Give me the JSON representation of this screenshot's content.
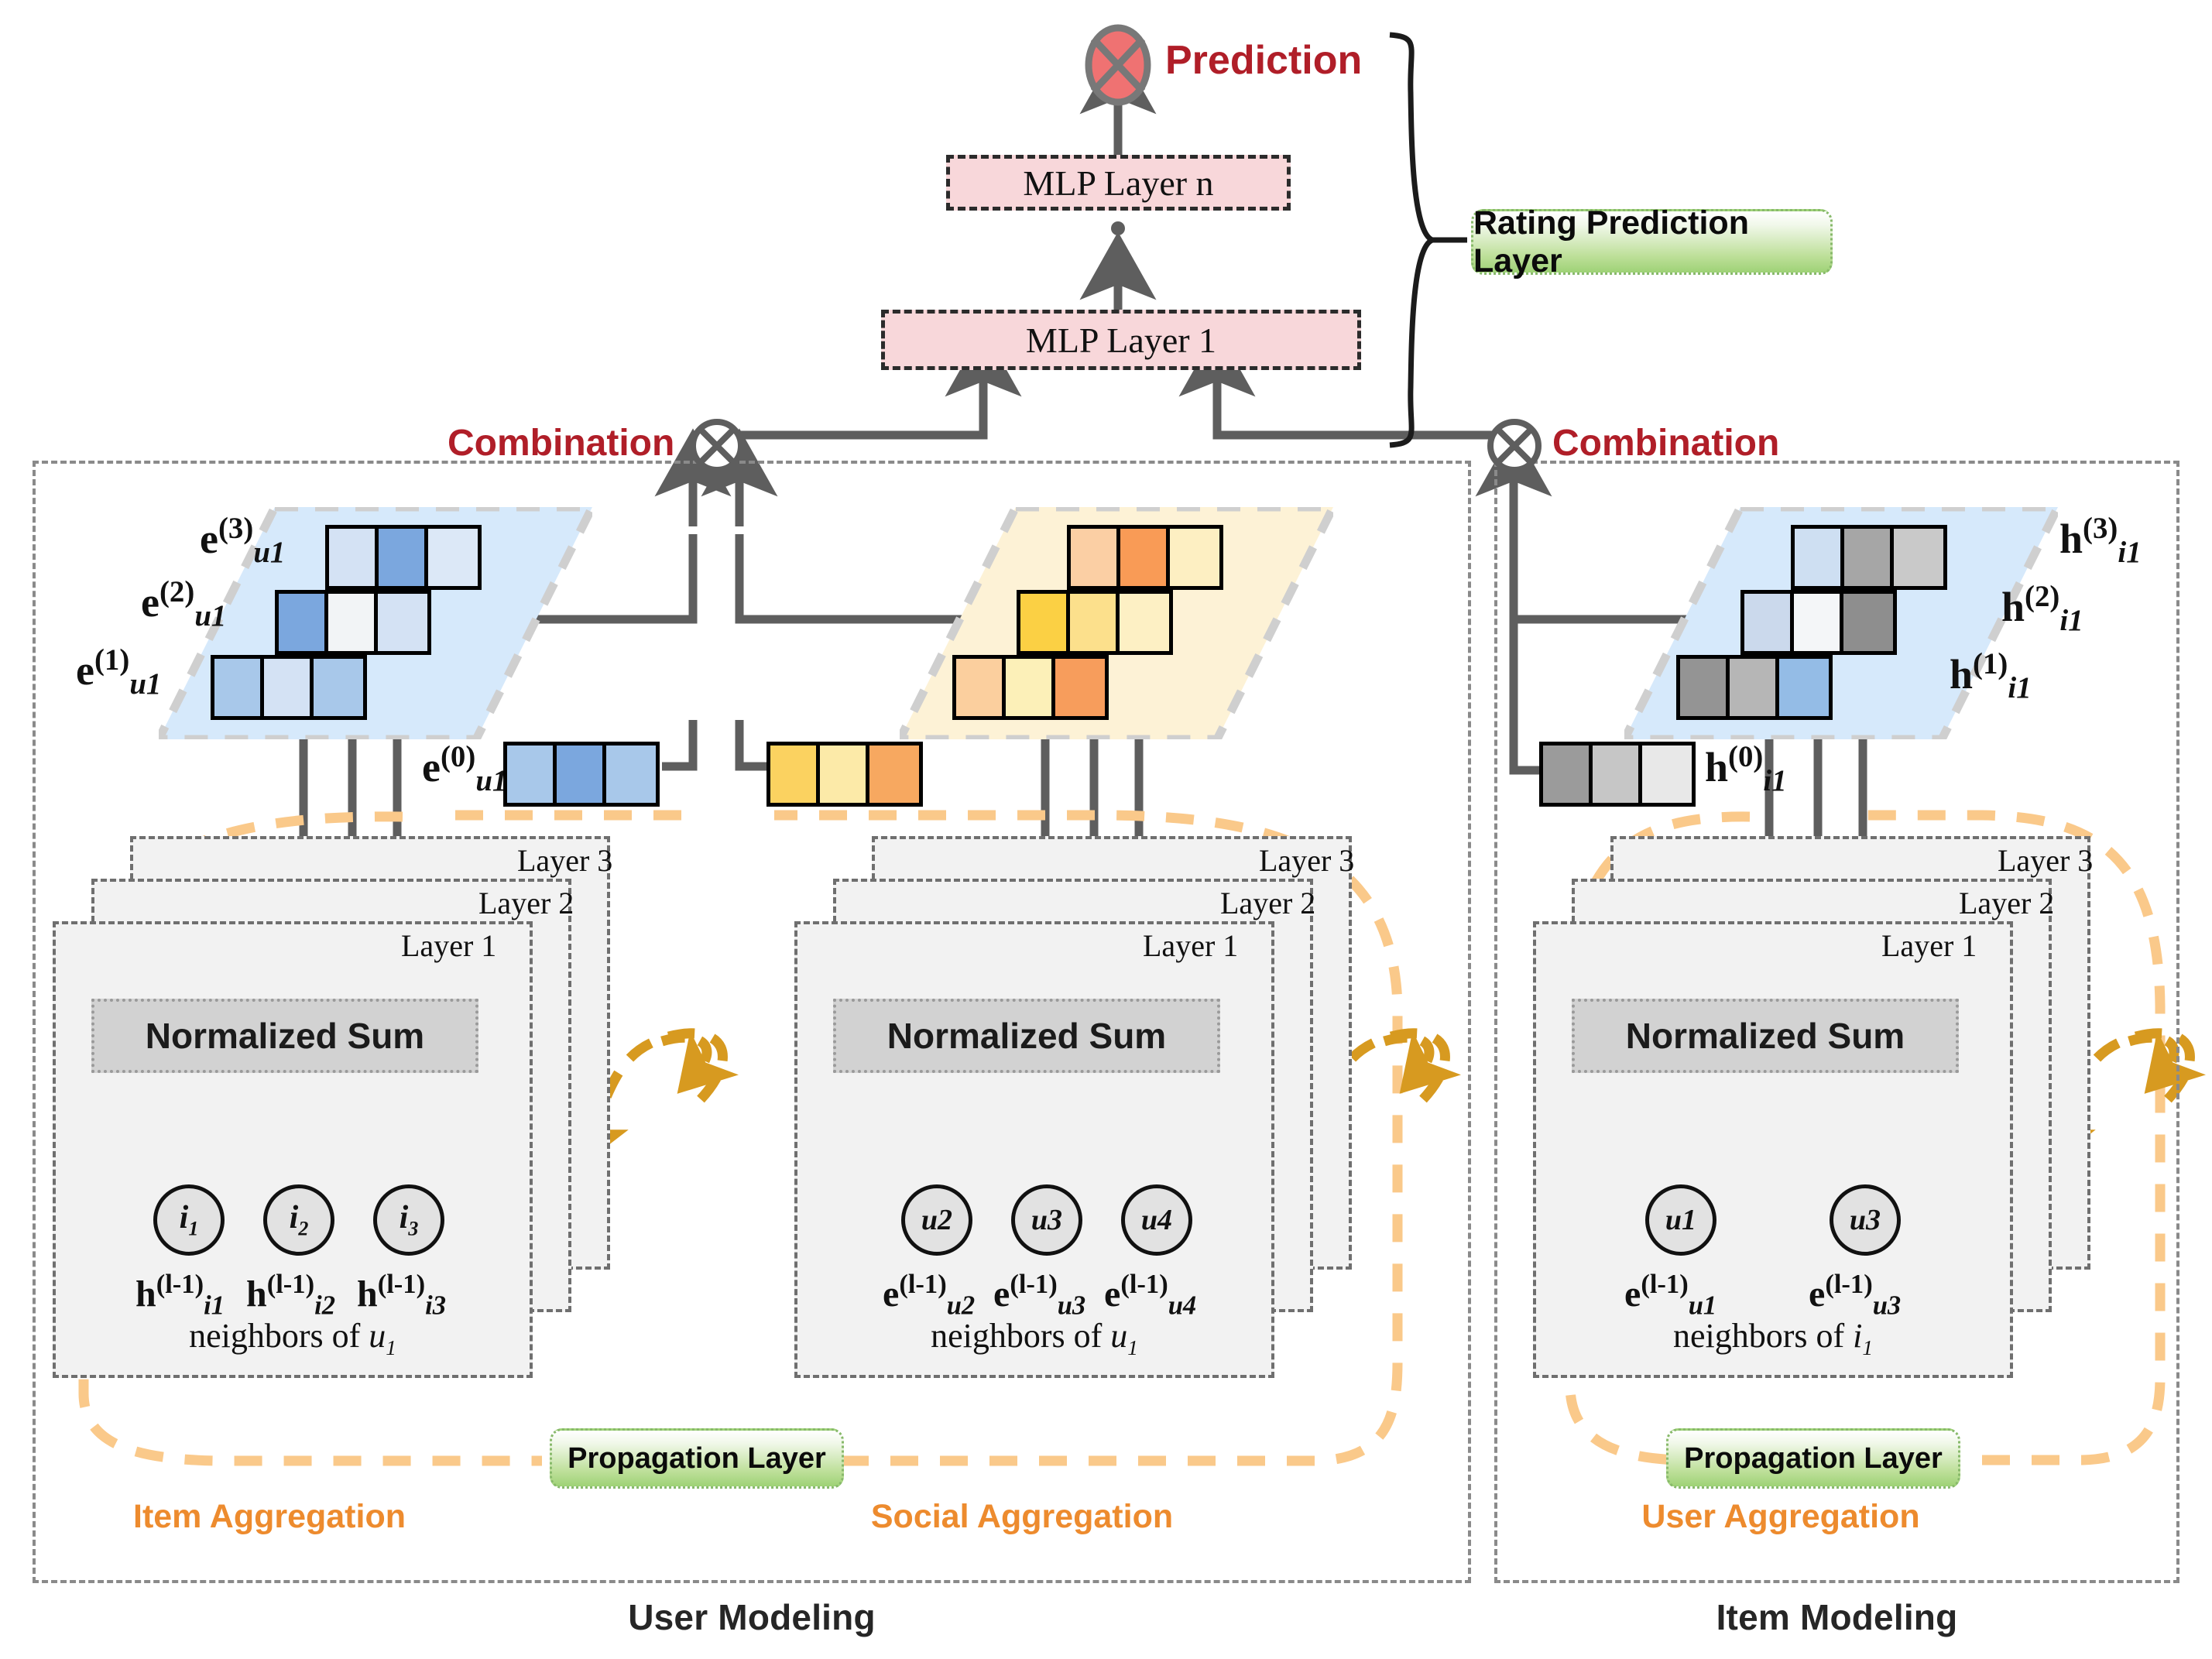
{
  "title_bottom": {
    "user_modeling": "User Modeling",
    "item_modeling": "Item Modeling"
  },
  "prediction": {
    "label": "Prediction",
    "icon": "prediction-circle-x-icon"
  },
  "mlp": {
    "top_label": "MLP Layer n",
    "bottom_label": "MLP Layer 1",
    "dots": "⋮"
  },
  "badges": {
    "rating_prediction": "Rating Prediction Layer",
    "propagation": "Propagation Layer"
  },
  "combination": {
    "left_label": "Combination",
    "right_label": "Combination",
    "icon": "combination-cross-circle-icon"
  },
  "aggregation_captions": {
    "item": "Item Aggregation",
    "social": "Social Aggregation",
    "user": "User Aggregation"
  },
  "layer_cards": {
    "layer1": "Layer 1",
    "layer2": "Layer 2",
    "layer3": "Layer 3",
    "normalized_sum": "Normalized Sum"
  },
  "columns": [
    {
      "id": "item-aggregation",
      "caption": "Item Aggregation",
      "neighbors_label": "neighbors of u",
      "neighbors_label_sub": "1",
      "nodes": [
        {
          "name": "i",
          "sub": "1",
          "embed": "h",
          "embed_sub": "i1",
          "embed_sup": "(l-1)"
        },
        {
          "name": "i",
          "sub": "2",
          "embed": "h",
          "embed_sub": "i2",
          "embed_sup": "(l-1)"
        },
        {
          "name": "i",
          "sub": "3",
          "embed": "h",
          "embed_sub": "i3",
          "embed_sup": "(l-1)"
        }
      ]
    },
    {
      "id": "social-aggregation",
      "caption": "Social Aggregation",
      "neighbors_label": "neighbors of u",
      "neighbors_label_sub": "1",
      "nodes": [
        {
          "name": "u2",
          "sub": "",
          "embed": "e",
          "embed_sub": "u2",
          "embed_sup": "(l-1)"
        },
        {
          "name": "u3",
          "sub": "",
          "embed": "e",
          "embed_sub": "u3",
          "embed_sup": "(l-1)"
        },
        {
          "name": "u4",
          "sub": "",
          "embed": "e",
          "embed_sub": "u4",
          "embed_sup": "(l-1)"
        }
      ]
    },
    {
      "id": "user-aggregation",
      "caption": "User Aggregation",
      "neighbors_label": "neighbors of i",
      "neighbors_label_sub": "1",
      "nodes": [
        {
          "name": "u1",
          "sub": "",
          "embed": "e",
          "embed_sub": "u1",
          "embed_sup": "(l-1)"
        },
        {
          "name": "u3",
          "sub": "",
          "embed": "e",
          "embed_sub": "u3",
          "embed_sup": "(l-1)"
        }
      ]
    }
  ],
  "embedding_groups": [
    {
      "id": "user-item-embeddings",
      "base": {
        "sym": "e",
        "sub": "u1",
        "sup": "(0)",
        "colors": [
          "#A8C8EA",
          "#7BA7DE",
          "#A8C8EA"
        ]
      },
      "layers": [
        {
          "sym": "e",
          "sub": "u1",
          "sup": "(1)",
          "colors": [
            "#A8C8EA",
            "#D4E2F4",
            "#A8C8EA"
          ]
        },
        {
          "sym": "e",
          "sub": "u1",
          "sup": "(2)",
          "colors": [
            "#7BA7DE",
            "#F2F4F6",
            "#D4E2F4"
          ]
        },
        {
          "sym": "e",
          "sub": "u1",
          "sup": "(3)",
          "colors": [
            "#D4E2F4",
            "#7BA7DE",
            "#DCE8F7"
          ]
        }
      ],
      "plane_color": "#D6E9FB"
    },
    {
      "id": "user-social-embeddings",
      "base": {
        "sym": "",
        "sub": "",
        "sup": "",
        "colors": [
          "#FBD260",
          "#FCEAA8",
          "#F7A860"
        ]
      },
      "layers": [
        {
          "sym": "",
          "sub": "",
          "sup": "",
          "colors": [
            "#FBCF9E",
            "#FCF0B8",
            "#F79D5C"
          ]
        },
        {
          "sym": "",
          "sub": "",
          "sup": "",
          "colors": [
            "#FBD044",
            "#FCE08C",
            "#FDF0C4"
          ]
        },
        {
          "sym": "",
          "sub": "",
          "sup": "",
          "colors": [
            "#FBCFA4",
            "#F99B56",
            "#FDEFC2"
          ]
        }
      ],
      "plane_color": "#FDF2D6"
    },
    {
      "id": "item-embeddings",
      "base": {
        "sym": "h",
        "sub": "i1",
        "sup": "(0)",
        "colors": [
          "#9B9B9B",
          "#C6C6C6",
          "#E8E8E8"
        ]
      },
      "layers": [
        {
          "sym": "h",
          "sub": "i1",
          "sup": "(1)",
          "colors": [
            "#949494",
            "#B6B6B6",
            "#94BCE6"
          ]
        },
        {
          "sym": "h",
          "sub": "i1",
          "sup": "(2)",
          "colors": [
            "#CBD9EC",
            "#F4F6F8",
            "#8E8E8E"
          ]
        },
        {
          "sym": "h",
          "sub": "i1",
          "sup": "(3)",
          "colors": [
            "#CEDFF2",
            "#A6A6A6",
            "#C9C9C9"
          ]
        }
      ],
      "plane_color": "#D6E9FB"
    }
  ],
  "colors": {
    "accent_red": "#B01E28",
    "accent_orange": "#ED8B2E",
    "dashed_orange": "#FAC98A",
    "arrow_gray": "#5E5E5E",
    "box_pink": "#F8D7DA",
    "plane_blue": "#D6E9FB",
    "plane_yellow": "#FDF2D6",
    "badge_green": "#9ED276"
  }
}
